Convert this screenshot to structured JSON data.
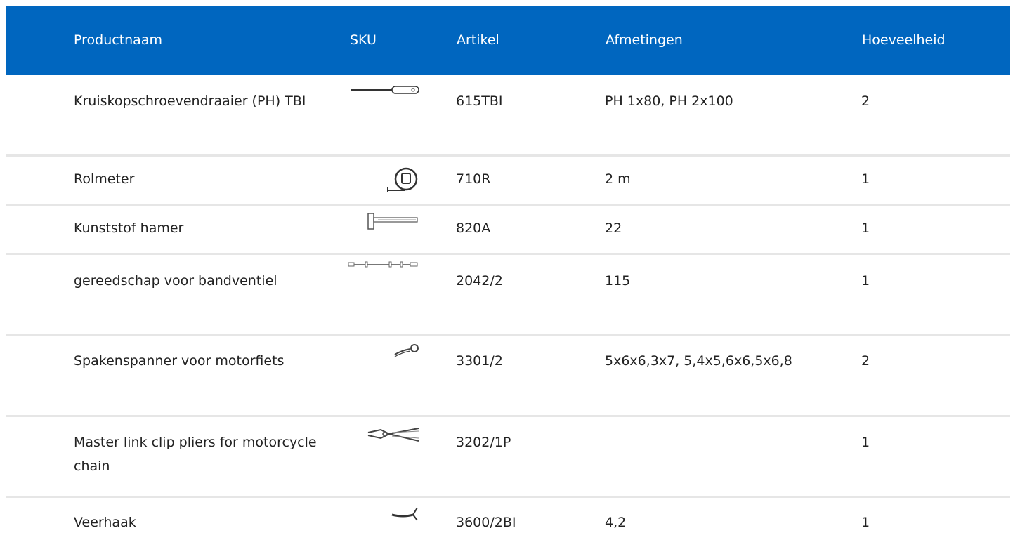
{
  "table": {
    "headers": {
      "name": "Productnaam",
      "sku": "SKU",
      "article": "Artikel",
      "dimensions": "Afmetingen",
      "quantity": "Hoeveelheid"
    },
    "rows": [
      {
        "name": "Kruiskopschroevendraaier (PH) TBI",
        "icon": "screwdriver-icon",
        "article": "615TBI",
        "dimensions": "PH 1x80, PH 2x100",
        "quantity": "2"
      },
      {
        "name": "Rolmeter",
        "icon": "tape-measure-icon",
        "article": "710R",
        "dimensions": "2 m",
        "quantity": "1"
      },
      {
        "name": "Kunststof hamer",
        "icon": "hammer-icon",
        "article": "820A",
        "dimensions": "22",
        "quantity": "1"
      },
      {
        "name": "gereedschap voor bandventiel",
        "icon": "valve-tool-icon",
        "article": "2042/2",
        "dimensions": "115",
        "quantity": "1"
      },
      {
        "name": "Spakenspanner voor motorfiets",
        "icon": "spoke-wrench-icon",
        "article": "3301/2",
        "dimensions": "5x6x6,3x7, 5,4x5,6x6,5x6,8",
        "quantity": "2"
      },
      {
        "name": "Master link clip pliers for motorcycle chain",
        "icon": "pliers-icon",
        "article": "3202/1P",
        "dimensions": "",
        "quantity": "1"
      },
      {
        "name": "Veerhaak",
        "icon": "spring-hook-icon",
        "article": "3600/2BI",
        "dimensions": "4,2",
        "quantity": "1"
      }
    ]
  },
  "colors": {
    "header_bg": "#0066bf",
    "header_text": "#ffffff",
    "row_divider": "#e6e6e6"
  }
}
